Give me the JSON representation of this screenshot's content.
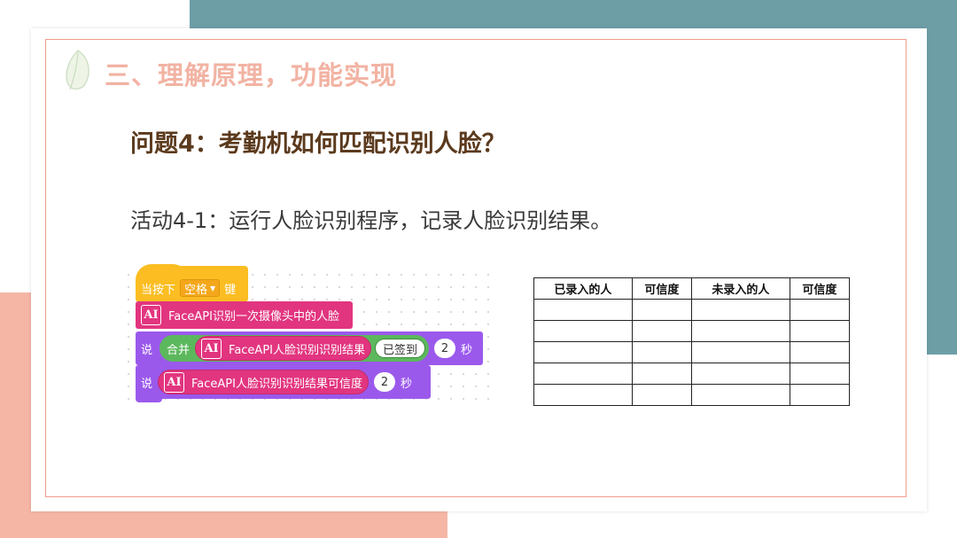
{
  "slide": {
    "section_title": "三、理解原理，功能实现",
    "question": "问题4：考勤机如何匹配识别人脸？",
    "activity": "活动4-1：运行人脸识别程序，记录人脸识别结果。",
    "colors": {
      "teal_band": "#6d9ea6",
      "salmon_band": "#f5b6a6",
      "border": "#ef9d8a",
      "title": "#f2b3a3",
      "question": "#5b3a1d"
    }
  },
  "code_blocks": {
    "hat": {
      "prefix": "当按下",
      "key": "空格",
      "suffix": "键"
    },
    "recognize": {
      "icon": "AI",
      "text": "FaceAPI识别一次摄像头中的人脸"
    },
    "say1": {
      "verb": "说",
      "join": "合并",
      "icon": "AI",
      "result": "FaceAPI人脸识别识别结果",
      "text_value": "已签到",
      "seconds": "2",
      "unit": "秒"
    },
    "say2": {
      "verb": "说",
      "icon": "AI",
      "confidence": "FaceAPI人脸识别识别结果可信度",
      "seconds": "2",
      "unit": "秒"
    }
  },
  "table": {
    "headers": [
      "已录入的人",
      "可信度",
      "未录入的人",
      "可信度"
    ],
    "rows": [
      [
        "",
        "",
        "",
        ""
      ],
      [
        "",
        "",
        "",
        ""
      ],
      [
        "",
        "",
        "",
        ""
      ],
      [
        "",
        "",
        "",
        ""
      ],
      [
        "",
        "",
        "",
        ""
      ]
    ]
  }
}
